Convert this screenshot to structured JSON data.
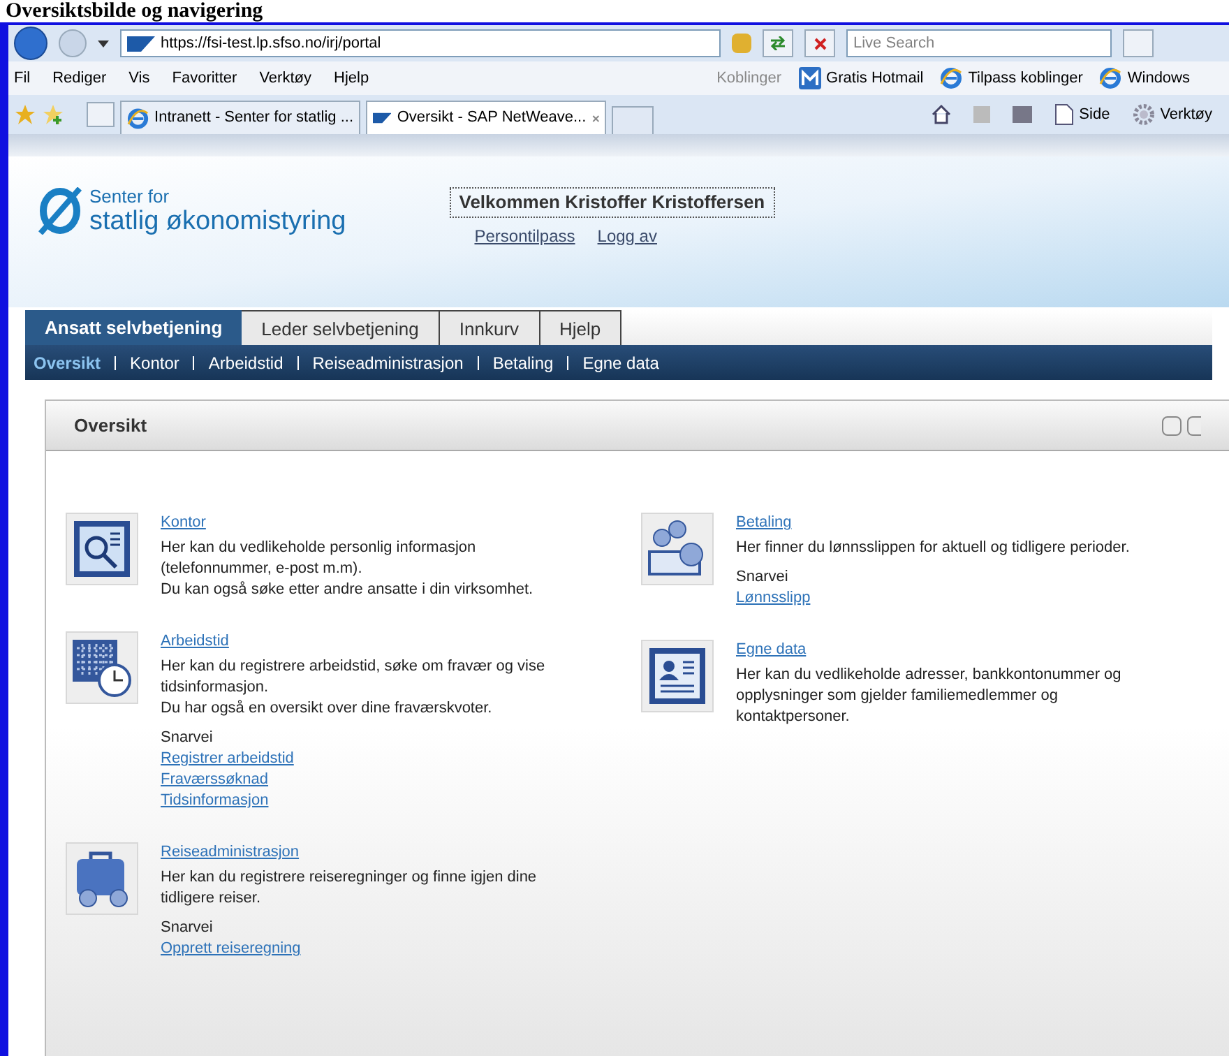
{
  "caption": "Oversiktsbilde og navigering",
  "browser": {
    "url": "https://fsi-test.lp.sfso.no/irj/portal",
    "search_placeholder": "Live Search",
    "menu": [
      "Fil",
      "Rediger",
      "Vis",
      "Favoritter",
      "Verktøy",
      "Hjelp"
    ],
    "links_label": "Koblinger",
    "links": [
      {
        "kind": "msn",
        "label": "Gratis Hotmail"
      },
      {
        "kind": "ie",
        "label": "Tilpass koblinger"
      },
      {
        "kind": "ie",
        "label": "Windows"
      }
    ],
    "tabs": [
      {
        "kind": "ie",
        "label": "Intranett - Senter for statlig ...",
        "selected": false
      },
      {
        "kind": "sap",
        "label": "Oversikt - SAP NetWeave...",
        "selected": true
      }
    ],
    "tools": [
      {
        "kind": "page",
        "label": "Side"
      },
      {
        "kind": "gear",
        "label": "Verktøy"
      }
    ]
  },
  "page": {
    "logo": {
      "line1": "Senter for",
      "line2": "statlig økonomistyring"
    },
    "welcome": "Velkommen Kristoffer Kristoffersen",
    "user_links": [
      "Persontilpass",
      "Logg av"
    ],
    "tabs": [
      {
        "label": "Ansatt selvbetjening",
        "selected": true
      },
      {
        "label": "Leder selvbetjening",
        "selected": false
      },
      {
        "label": "Innkurv",
        "selected": false
      },
      {
        "label": "Hjelp",
        "selected": false
      }
    ],
    "subnav": [
      {
        "label": "Oversikt",
        "selected": true
      },
      {
        "label": "Kontor",
        "selected": false
      },
      {
        "label": "Arbeidstid",
        "selected": false
      },
      {
        "label": "Reiseadministrasjon",
        "selected": false
      },
      {
        "label": "Betaling",
        "selected": false
      },
      {
        "label": "Egne data",
        "selected": false
      }
    ],
    "panel": {
      "title": "Oversikt",
      "columns": [
        [
          {
            "kind": "contacts",
            "title": "Kontor",
            "lines": [
              "Her kan du vedlikeholde personlig informasjon",
              "(telefonnummer, e-post m.m).",
              "Du kan også søke etter andre ansatte i din virksomhet."
            ]
          },
          {
            "kind": "calendar",
            "title": "Arbeidstid",
            "lines": [
              "Her kan du registrere arbeidstid, søke om fravær og vise",
              "tidsinformasjon.",
              "Du har også en oversikt over dine fraværskvoter."
            ],
            "shortcut_label": "Snarvei",
            "shortcuts": [
              "Registrer arbeidstid",
              "Fraværssøknad",
              "Tidsinformasjon"
            ]
          },
          {
            "kind": "travel",
            "title": "Reiseadministrasjon",
            "lines": [
              "Her kan du registrere reiseregninger og finne igjen dine",
              "tidligere reiser."
            ],
            "shortcut_label": "Snarvei",
            "shortcuts": [
              "Opprett reiseregning"
            ]
          }
        ],
        [
          {
            "kind": "money",
            "title": "Betaling",
            "lines": [
              "Her finner du lønnsslippen for aktuell og tidligere perioder."
            ],
            "shortcut_label": "Snarvei",
            "shortcuts": [
              "Lønnsslipp"
            ]
          },
          {
            "kind": "profile",
            "title": "Egne data",
            "lines": [
              "Her kan du vedlikeholde adresser, bankkontonummer og",
              "opplysninger som gjelder familiemedlemmer og",
              "kontaktpersoner."
            ]
          }
        ]
      ]
    }
  }
}
